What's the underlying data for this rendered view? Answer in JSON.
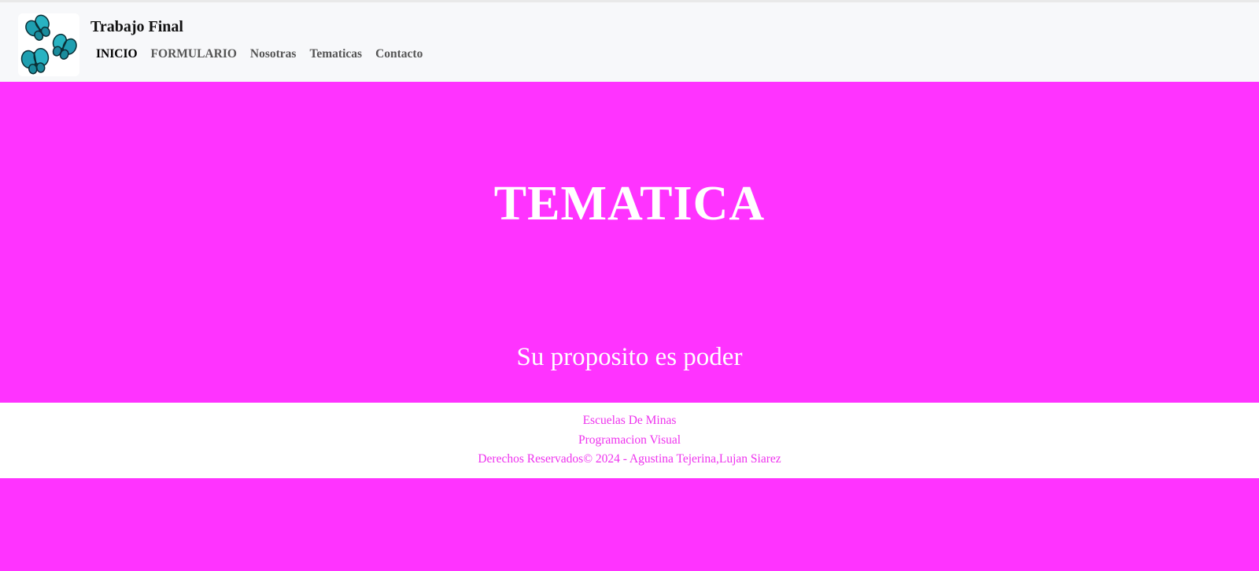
{
  "navbar": {
    "brand": "Trabajo Final",
    "logo_icon": "butterflies-logo-icon",
    "links": [
      {
        "label": "INICIO",
        "active": true
      },
      {
        "label": "FORMULARIO",
        "active": false
      },
      {
        "label": "Nosotras",
        "active": false
      },
      {
        "label": "Tematicas",
        "active": false
      },
      {
        "label": "Contacto",
        "active": false
      }
    ]
  },
  "hero": {
    "title": "TEMATICA",
    "subtitle": "Su proposito es poder"
  },
  "footer": {
    "line1": "Escuelas De Minas",
    "line2": "Programacion Visual",
    "line3": "Derechos Reservados© 2024 - Agustina Tejerina,Lujan Siarez"
  },
  "colors": {
    "accent": "#ff33ff",
    "footer_text": "#ee33ee",
    "navbar_bg": "#f7f8fa",
    "butterfly": "#1f9fb0"
  }
}
